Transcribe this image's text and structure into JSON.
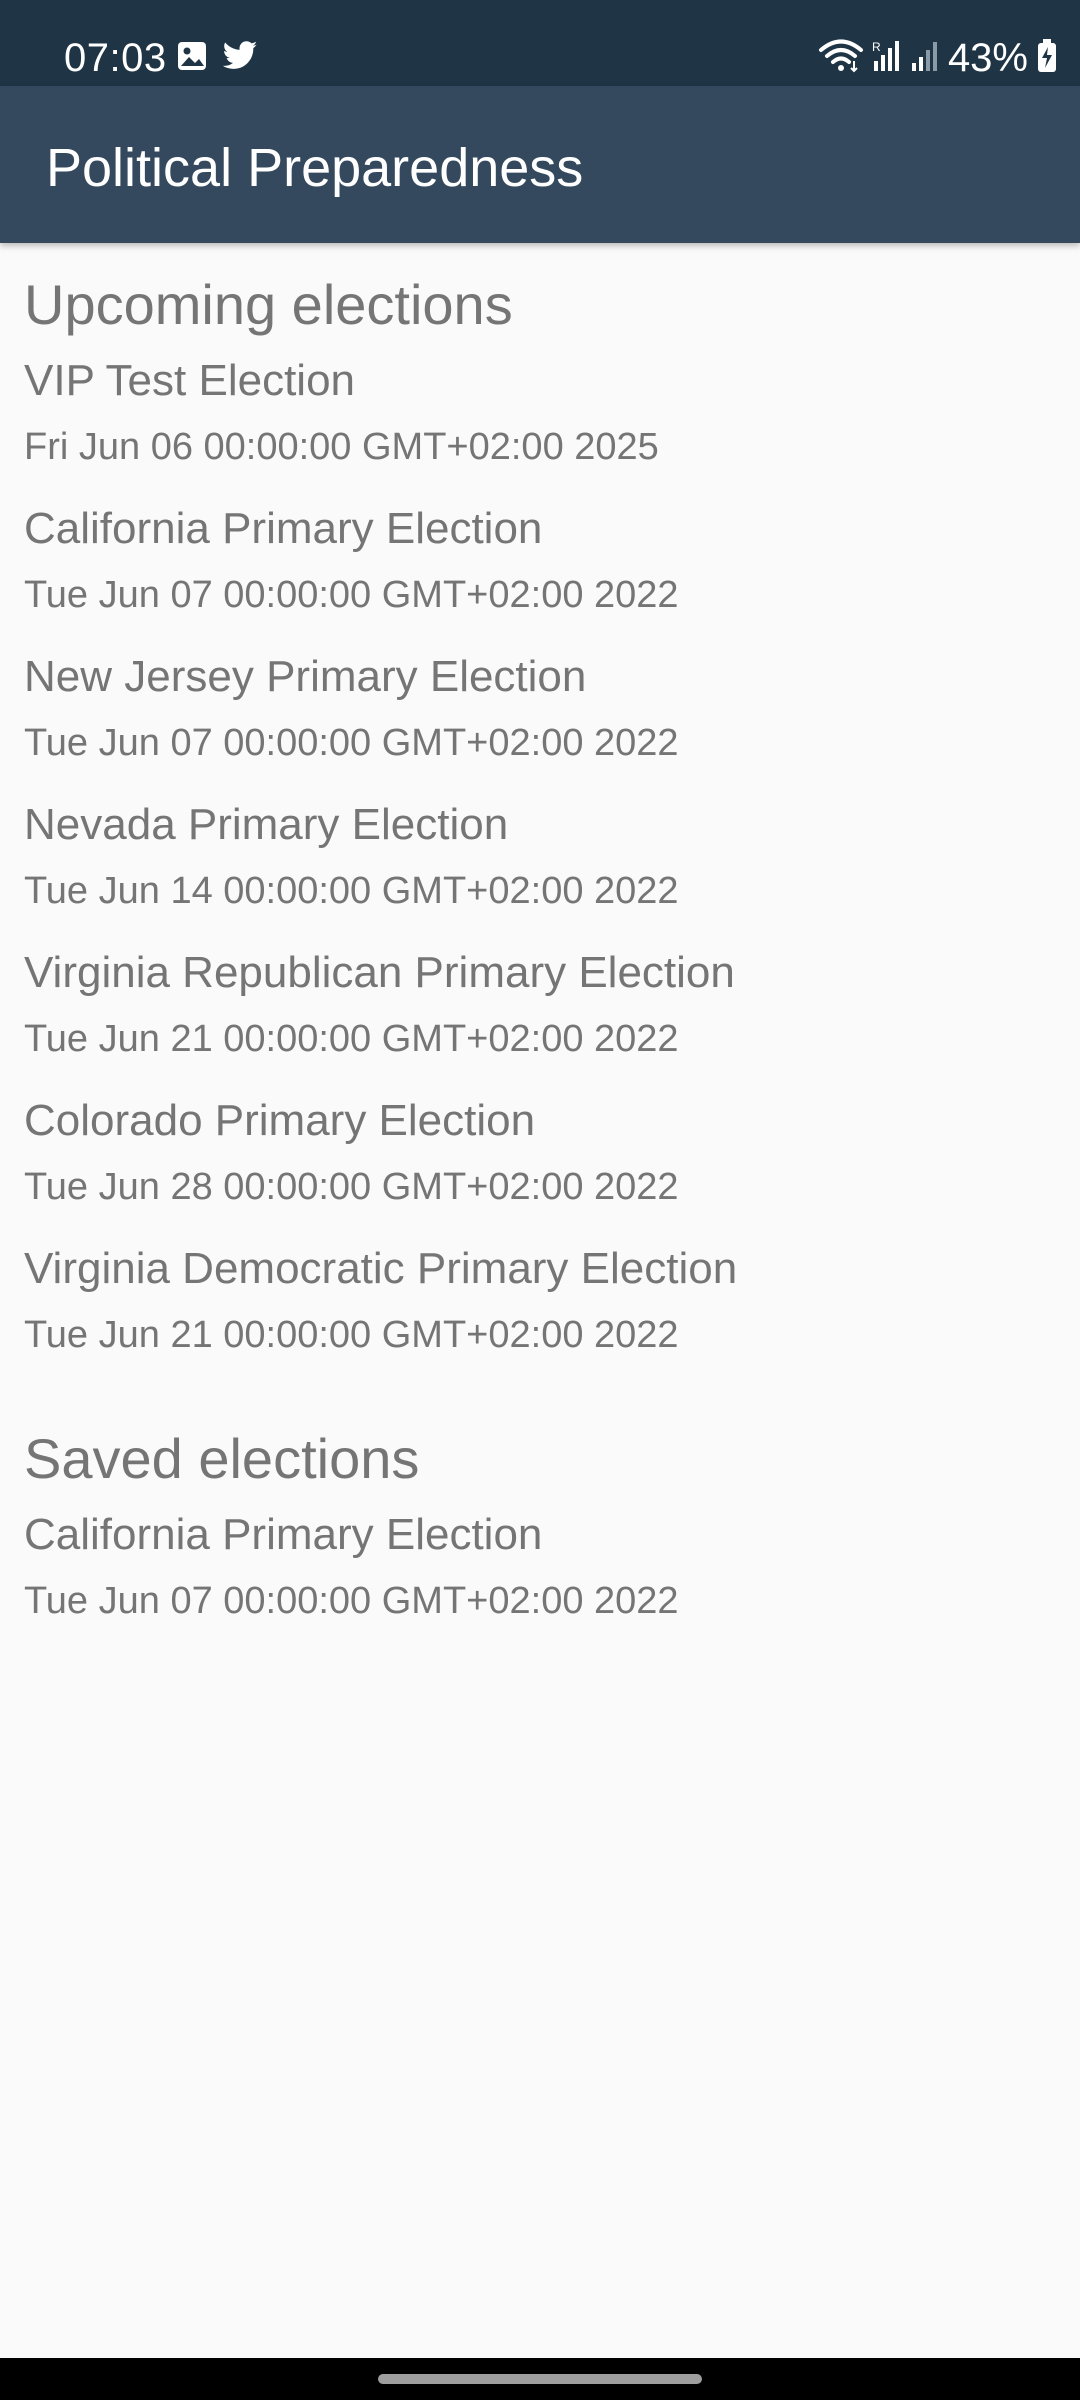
{
  "status_bar": {
    "time": "07:03",
    "battery": "43%",
    "icons": [
      "image-icon",
      "twitter-icon",
      "wifi-icon",
      "signal-roaming-icon",
      "signal-icon",
      "battery-charging-icon"
    ]
  },
  "app_bar": {
    "title": "Political Preparedness"
  },
  "upcoming": {
    "header": "Upcoming elections",
    "items": [
      {
        "name": "VIP Test Election",
        "date": "Fri Jun 06 00:00:00 GMT+02:00 2025"
      },
      {
        "name": "California Primary Election",
        "date": "Tue Jun 07 00:00:00 GMT+02:00 2022"
      },
      {
        "name": "New Jersey Primary Election",
        "date": "Tue Jun 07 00:00:00 GMT+02:00 2022"
      },
      {
        "name": "Nevada Primary Election",
        "date": "Tue Jun 14 00:00:00 GMT+02:00 2022"
      },
      {
        "name": "Virginia Republican Primary Election",
        "date": "Tue Jun 21 00:00:00 GMT+02:00 2022"
      },
      {
        "name": "Colorado Primary Election",
        "date": "Tue Jun 28 00:00:00 GMT+02:00 2022"
      },
      {
        "name": "Virginia Democratic Primary Election",
        "date": "Tue Jun 21 00:00:00 GMT+02:00 2022"
      }
    ]
  },
  "saved": {
    "header": "Saved elections",
    "items": [
      {
        "name": "California Primary Election",
        "date": "Tue Jun 07 00:00:00 GMT+02:00 2022"
      }
    ]
  },
  "colors": {
    "status_bar": "#1f3545",
    "app_bar": "#34495e",
    "background": "#fafafa",
    "text_gray": "#757575"
  }
}
